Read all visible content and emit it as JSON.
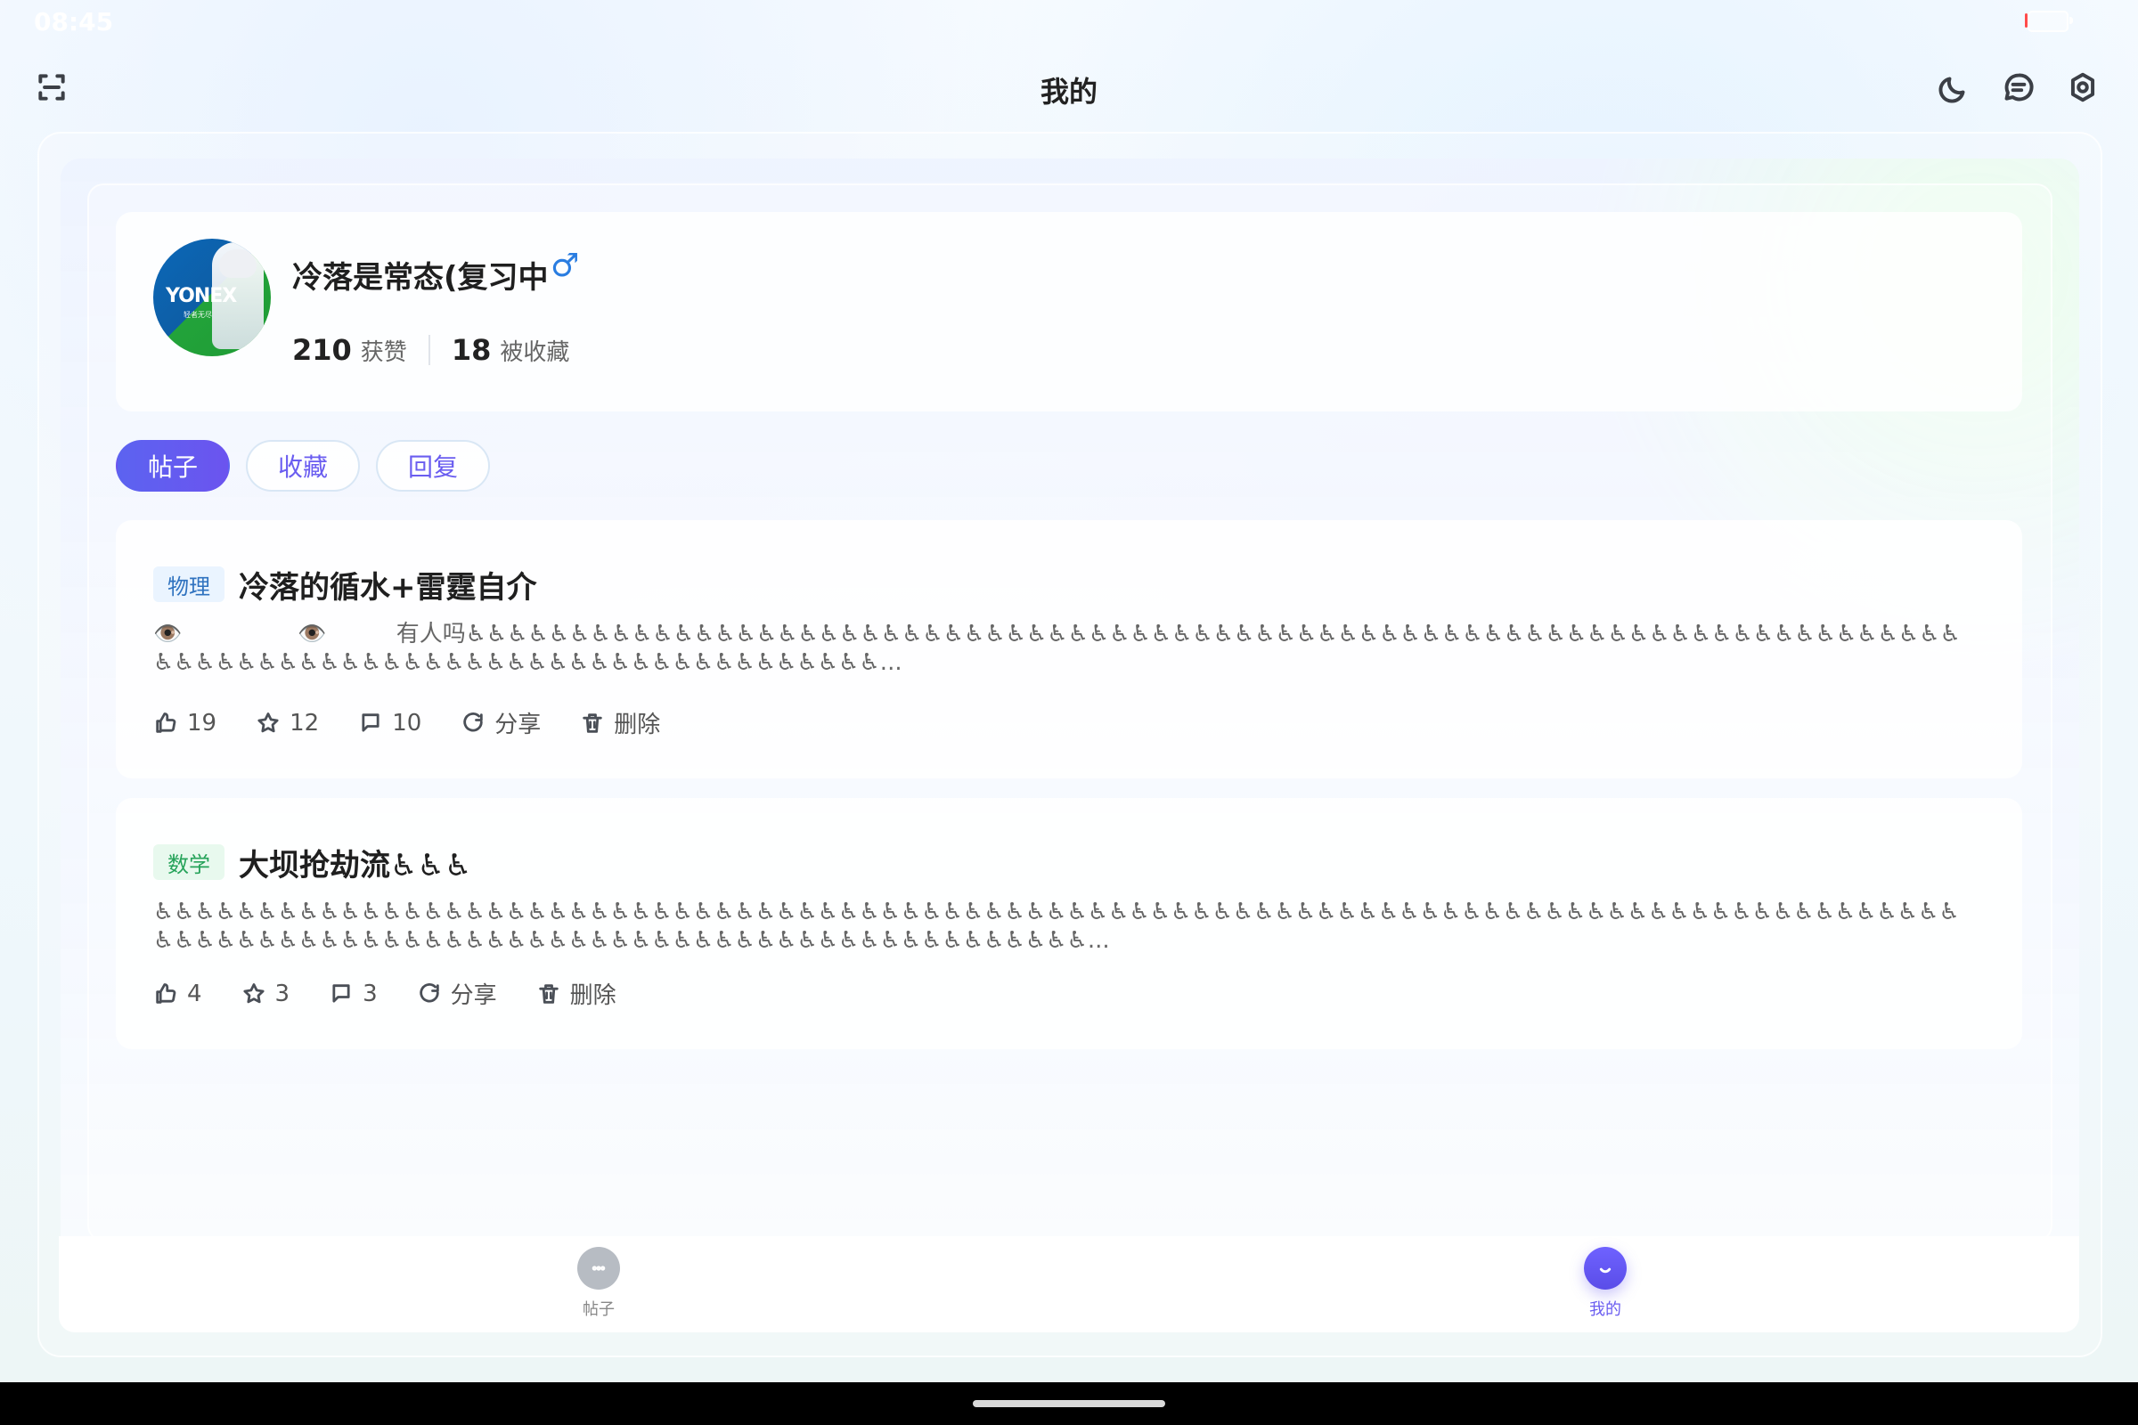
{
  "status": {
    "time": "08:45"
  },
  "header": {
    "title": "我的"
  },
  "profile": {
    "name": "冷落是常态(复习中",
    "gender_symbol": "♂",
    "likes": "210",
    "likes_label": "获赞",
    "collected": "18",
    "collected_label": "被收藏",
    "avatar_text": "YONEX",
    "avatar_sub": "轻者无尽"
  },
  "tabs": [
    {
      "label": "帖子"
    },
    {
      "label": "收藏"
    },
    {
      "label": "回复"
    }
  ],
  "posts": [
    {
      "tag": "物理",
      "title": "冷落的循水+雷霆自介",
      "preview": "👁️　　　　　👁️　　　有人吗♿♿♿♿♿♿♿♿♿♿♿♿♿♿♿♿♿♿♿♿♿♿♿♿♿♿♿♿♿♿♿♿♿♿♿♿♿♿♿♿♿♿♿♿♿♿♿♿♿♿♿♿♿♿♿♿♿♿♿♿♿♿♿♿♿♿♿♿♿♿♿♿♿♿♿♿♿♿♿♿♿♿♿♿♿♿♿♿♿♿♿♿♿♿♿♿♿♿♿♿♿♿♿♿♿♿♿...",
      "likes": "19",
      "stars": "12",
      "comments": "10",
      "share": "分享",
      "delete": "删除"
    },
    {
      "tag": "数学",
      "title": "大坝抢劫流♿♿♿",
      "preview": "♿♿♿♿♿♿♿♿♿♿♿♿♿♿♿♿♿♿♿♿♿♿♿♿♿♿♿♿♿♿♿♿♿♿♿♿♿♿♿♿♿♿♿♿♿♿♿♿♿♿♿♿♿♿♿♿♿♿♿♿♿♿♿♿♿♿♿♿♿♿♿♿♿♿♿♿♿♿♿♿♿♿♿♿♿♿♿♿♿♿♿♿♿♿♿♿♿♿♿♿♿♿♿♿♿♿♿♿♿♿♿♿♿♿♿♿♿♿♿♿♿♿♿♿♿♿♿♿♿♿♿♿...",
      "likes": "4",
      "stars": "3",
      "comments": "3",
      "share": "分享",
      "delete": "删除"
    }
  ],
  "bottom_nav": {
    "posts": "帖子",
    "mine": "我的"
  },
  "icons": {
    "scan": "scan-icon",
    "moon": "moon-icon",
    "message": "message-icon",
    "settings": "settings-icon",
    "like": "thumb-up-icon",
    "star": "star-icon",
    "comment": "comment-icon",
    "share": "share-icon",
    "delete": "trash-icon",
    "posts_nav": "chat-bubble-icon",
    "mine_nav": "profile-smile-icon"
  },
  "colors": {
    "accent": "#6a5df0",
    "physics_tag": "#2f72bf",
    "math_tag": "#26a35a",
    "gender": "#2a7de1"
  }
}
